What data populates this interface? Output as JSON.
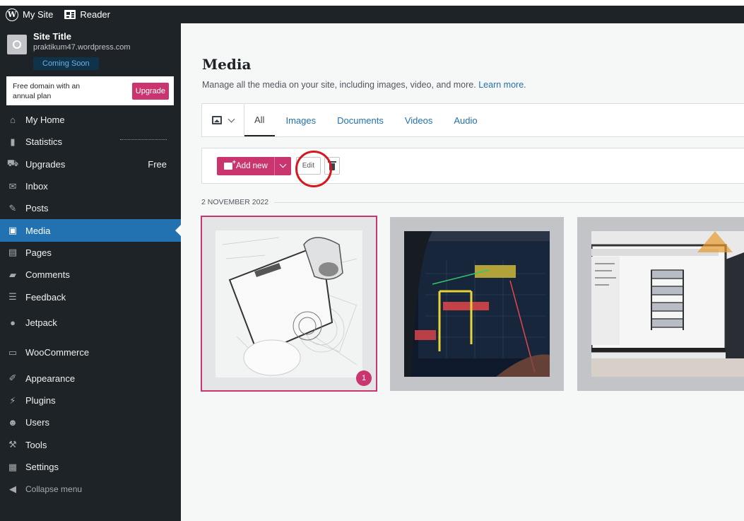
{
  "topbar": {
    "my_site": "My Site",
    "reader": "Reader"
  },
  "site": {
    "title": "Site Title",
    "url": "praktikum47.wordpress.com",
    "status": "Coming Soon"
  },
  "upsell": {
    "text": "Free domain with an annual plan",
    "button": "Upgrade"
  },
  "menu": [
    {
      "label": "My Home",
      "icon": "home-icon"
    },
    {
      "label": "Statistics",
      "icon": "bar-chart-icon"
    },
    {
      "label": "Upgrades",
      "icon": "cart-icon",
      "suffix": "Free"
    },
    {
      "label": "Inbox",
      "icon": "mail-icon"
    },
    {
      "label": "Posts",
      "icon": "pin-icon"
    },
    {
      "label": "Media",
      "icon": "media-icon",
      "active": true
    },
    {
      "label": "Pages",
      "icon": "page-icon"
    },
    {
      "label": "Comments",
      "icon": "comment-icon"
    },
    {
      "label": "Feedback",
      "icon": "feedback-icon"
    },
    {
      "label": "Jetpack",
      "icon": "jetpack-icon"
    },
    {
      "label": "WooCommerce",
      "icon": "woo-icon"
    },
    {
      "label": "Appearance",
      "icon": "brush-icon"
    },
    {
      "label": "Plugins",
      "icon": "plug-icon"
    },
    {
      "label": "Users",
      "icon": "user-icon"
    },
    {
      "label": "Tools",
      "icon": "wrench-icon"
    },
    {
      "label": "Settings",
      "icon": "settings-icon"
    },
    {
      "label": "Collapse menu",
      "icon": "collapse-icon"
    }
  ],
  "page": {
    "title": "Media",
    "subtitle": "Manage all the media on your site, including images, video, and more.",
    "learn_more": "Learn more."
  },
  "filter_tabs": [
    "All",
    "Images",
    "Documents",
    "Videos",
    "Audio"
  ],
  "actions": {
    "add_new": "Add new",
    "edit": "Edit"
  },
  "date_group": "2 NOVEMBER 2022",
  "media": [
    {
      "selected": true,
      "badge": "1",
      "desc": "sketch-with-headphones"
    },
    {
      "selected": false,
      "desc": "cad-drawing-monitor"
    },
    {
      "selected": false,
      "desc": "3d-model-monitor"
    }
  ],
  "colors": {
    "accent": "#c9356e",
    "sidebar": "#1d2327",
    "active": "#2271b1",
    "annotation": "#d6171e"
  }
}
